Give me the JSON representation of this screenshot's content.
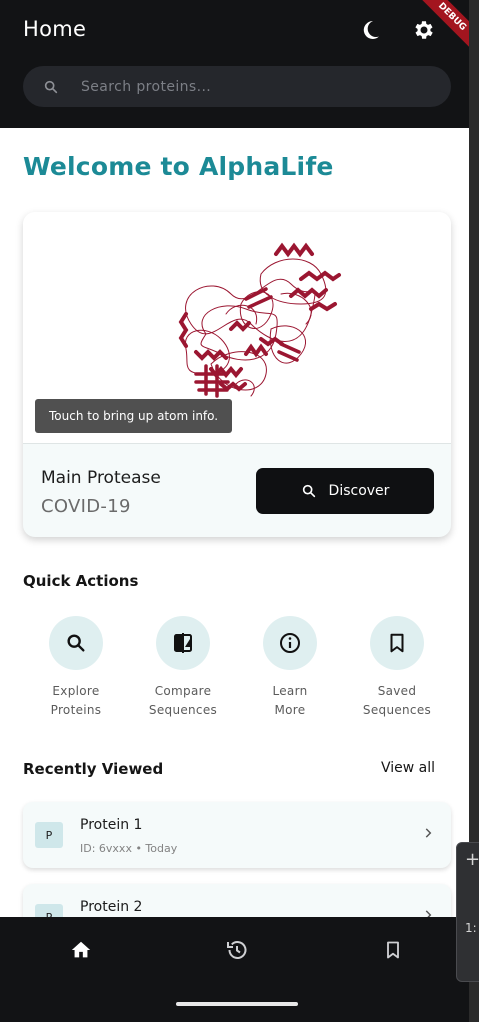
{
  "appbar": {
    "title": "Home",
    "debug_label": "DEBUG"
  },
  "search": {
    "placeholder": "Search proteins..."
  },
  "welcome": {
    "title": "Welcome to AlphaLife"
  },
  "hero": {
    "tooltip": "Touch to bring up atom info.",
    "protein_name": "Main Protease",
    "protein_sub": "COVID-19",
    "discover_label": "Discover",
    "protein_color": "#9b1631"
  },
  "quick_actions": {
    "title": "Quick Actions",
    "items": [
      {
        "label_line1": "Explore",
        "label_line2": "Proteins",
        "icon": "search-icon"
      },
      {
        "label_line1": "Compare",
        "label_line2": "Sequences",
        "icon": "compare-icon"
      },
      {
        "label_line1": "Learn",
        "label_line2": "More",
        "icon": "info-icon"
      },
      {
        "label_line1": "Saved",
        "label_line2": "Sequences",
        "icon": "bookmark-icon"
      }
    ]
  },
  "recently_viewed": {
    "title": "Recently Viewed",
    "view_all": "View all",
    "items": [
      {
        "badge": "P",
        "name": "Protein 1",
        "meta": "ID: 6vxxx • Today"
      },
      {
        "badge": "P",
        "name": "Protein 2",
        "meta": ""
      }
    ]
  },
  "bottom_nav": {
    "items": [
      "home-icon",
      "history-icon",
      "bookmark-icon"
    ]
  },
  "side_panel": {
    "plus": "+",
    "ratio": "1:"
  },
  "colors": {
    "accent": "#1c8a96",
    "dark": "#121315",
    "card": "#f5fafa"
  }
}
